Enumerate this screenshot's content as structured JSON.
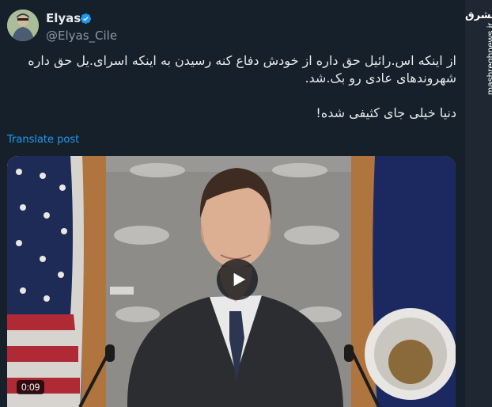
{
  "tweet": {
    "author_name": "Elyas",
    "author_handle": "@Elyas_Cile",
    "text_lines": [
      "از اینکه اس.رائیل حق داره از خودش دفاع کنه رسیدن به اینکه اسرای.یل حق داره شهروندهای عادی رو بک.شد.",
      "دنیا خیلی جای کثیفی شده!"
    ],
    "translate_label": "Translate post"
  },
  "video": {
    "duration": "0:09"
  },
  "watermark": {
    "logo": "مشرق",
    "url": "mashreghnews.ir"
  },
  "icons": {
    "verified": "verified-badge-icon",
    "play": "play-icon"
  },
  "colors": {
    "background": "#15202b",
    "link": "#1d9bf0",
    "verified": "#1d9bf0",
    "text": "#e7e9ea",
    "muted": "#8b98a5"
  }
}
